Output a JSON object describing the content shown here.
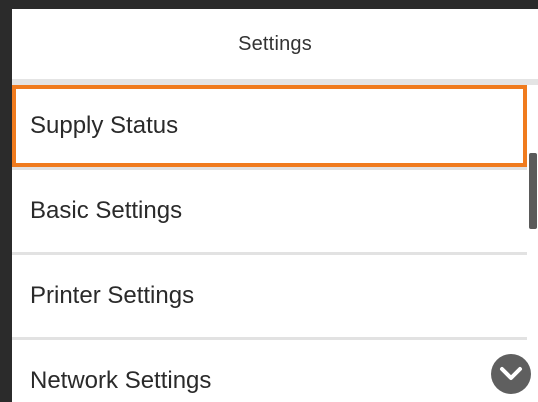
{
  "header": {
    "title": "Settings"
  },
  "menu": {
    "items": [
      {
        "label": "Supply Status",
        "selected": true
      },
      {
        "label": "Basic Settings",
        "selected": false
      },
      {
        "label": "Printer Settings",
        "selected": false
      },
      {
        "label": "Network Settings",
        "selected": false
      }
    ]
  },
  "scroll": {
    "down_icon": "chevron-down-icon"
  },
  "colors": {
    "selection_border": "#f07b1e",
    "frame": "#2b2b2b",
    "scroll_button": "#5f5f5f"
  }
}
